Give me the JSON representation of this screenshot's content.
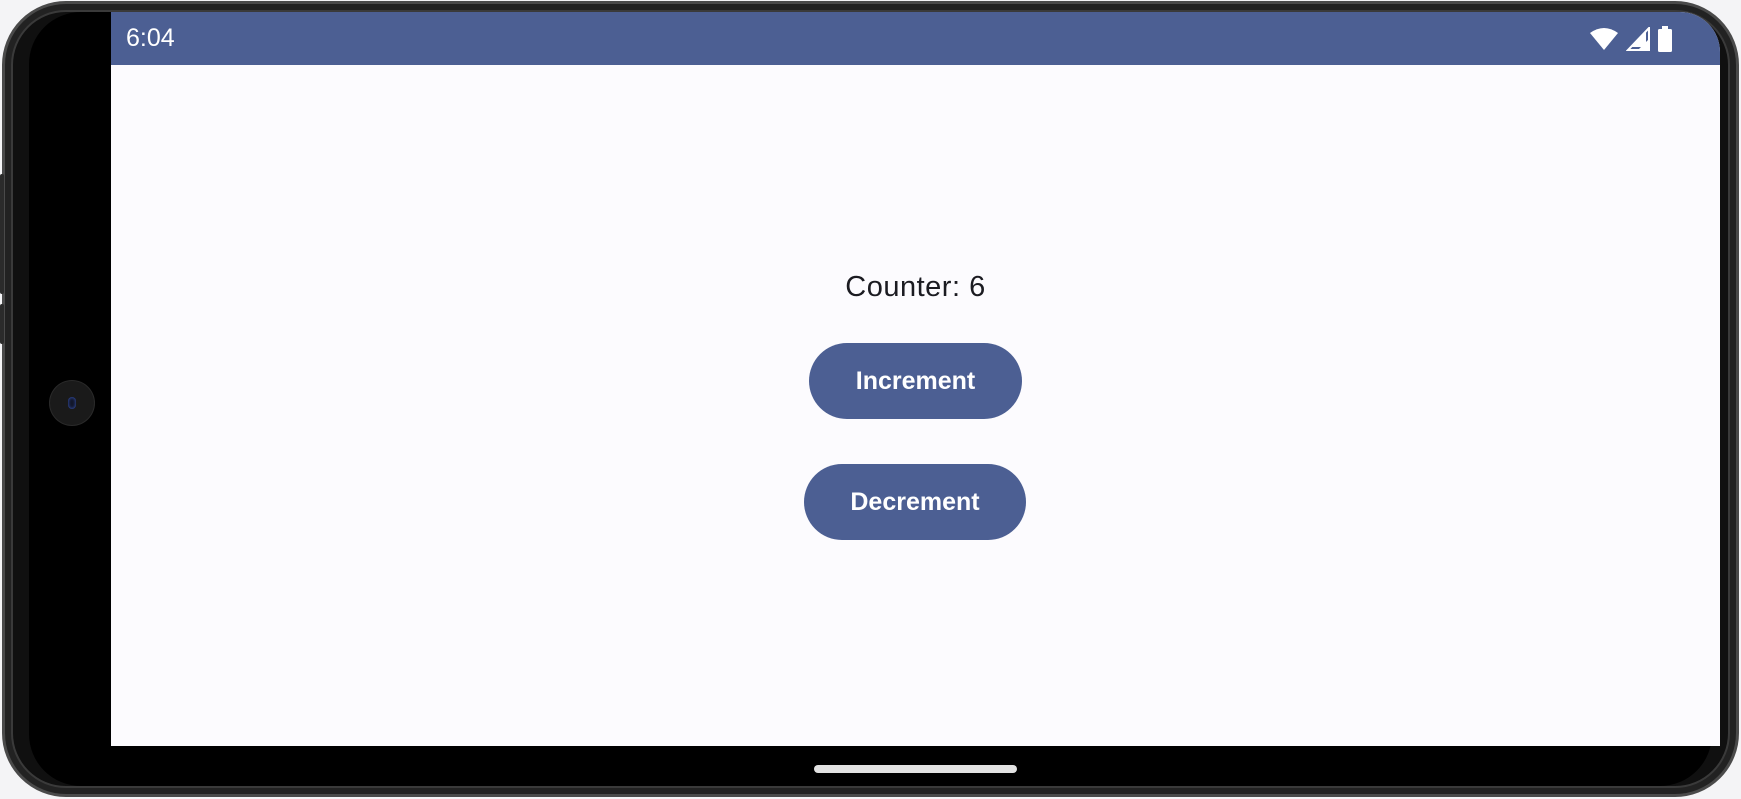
{
  "status_bar": {
    "time": "6:04",
    "icons": [
      "wifi-icon",
      "cellular-signal-icon",
      "battery-icon"
    ],
    "color": "#4c5f93"
  },
  "app": {
    "counter_text": "Counter: 6",
    "counter_value": 6,
    "increment_label": "Increment",
    "decrement_label": "Decrement",
    "button_color": "#4c5f93",
    "background_color": "#fcfbfe"
  },
  "navigation": {
    "gesture_handle": "home-gesture-bar"
  }
}
